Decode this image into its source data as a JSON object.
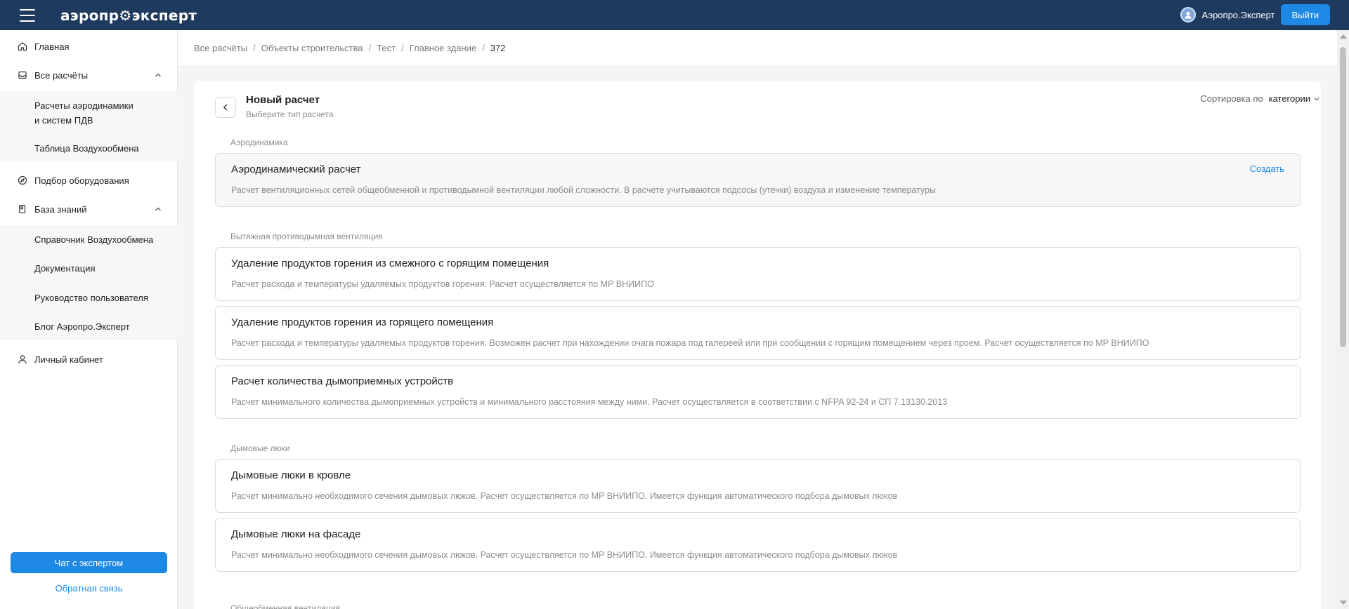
{
  "header": {
    "logo": "аэропр⚙эксперт",
    "user_name": "Аэропро.Эксперт",
    "logout_label": "Выйти"
  },
  "sidebar": {
    "home": "Главная",
    "all_calcs": "Все расчёты",
    "all_calcs_sub": [
      "Расчеты аэродинамики",
      "и систем ПДВ",
      "Таблица Воздухообмена"
    ],
    "equipment": "Подбор оборудования",
    "knowledge": "База знаний",
    "knowledge_sub": [
      "Справочник Воздухообмена",
      "Документация",
      "Руководство пользователя",
      "Блог Аэропро.Эксперт"
    ],
    "account": "Личный кабинет",
    "chat_button": "Чат с экспертом",
    "feedback_link": "Обратная связь"
  },
  "breadcrumb": [
    "Все расчёты",
    "Объекты строительства",
    "Тест",
    "Главное здание",
    "372"
  ],
  "panel": {
    "title": "Новый расчет",
    "subtitle": "Выберите тип расчета",
    "sort_label": "Сортировка по",
    "sort_value": "категории"
  },
  "sections": [
    {
      "label": "Аэродинамика",
      "cards": [
        {
          "title": "Аэродинамический расчет",
          "desc": "Расчет вентиляционных сетей общеобменной и противодымной вентиляции любой сложности. В расчете учитываются подсосы (утечки) воздуха и изменение температуры",
          "action": "Создать"
        }
      ]
    },
    {
      "label": "Вытяжная противодымная вентиляция",
      "cards": [
        {
          "title": "Удаление продуктов горения из смежного с горящим помещения",
          "desc": "Расчет расхода и температуры удаляемых продуктов горения. Расчет осуществляется по МР ВНИИПО"
        },
        {
          "title": "Удаление продуктов горения из горящего помещения",
          "desc": "Расчет расхода и температуры удаляемых продуктов горения. Возможен расчет при нахождении очага пожара под галереей или при сообщении с горящим помещением через проем. Расчет осуществляется по МР ВНИИПО"
        },
        {
          "title": "Расчет количества дымоприемных устройств",
          "desc": "Расчет минимального количества дымоприемных устройств и минимального расстояния между ними. Расчет осуществляется в соответствии с NFPA 92-24 и СП 7.13130.2013"
        }
      ]
    },
    {
      "label": "Дымовые люки",
      "cards": [
        {
          "title": "Дымовые люки в кровле",
          "desc": "Расчет минимально необходимого сечения дымовых люков. Расчет осуществляется по МР ВНИИПО. Имеется функция автоматического подбора дымовых люков"
        },
        {
          "title": "Дымовые люки на фасаде",
          "desc": "Расчет минимально необходимого сечения дымовых люков. Расчет осуществляется по МР ВНИИПО. Имеется функция автоматического подбора дымовых люков"
        }
      ]
    },
    {
      "label": "Общеобменная вентиляция",
      "cards": []
    }
  ]
}
